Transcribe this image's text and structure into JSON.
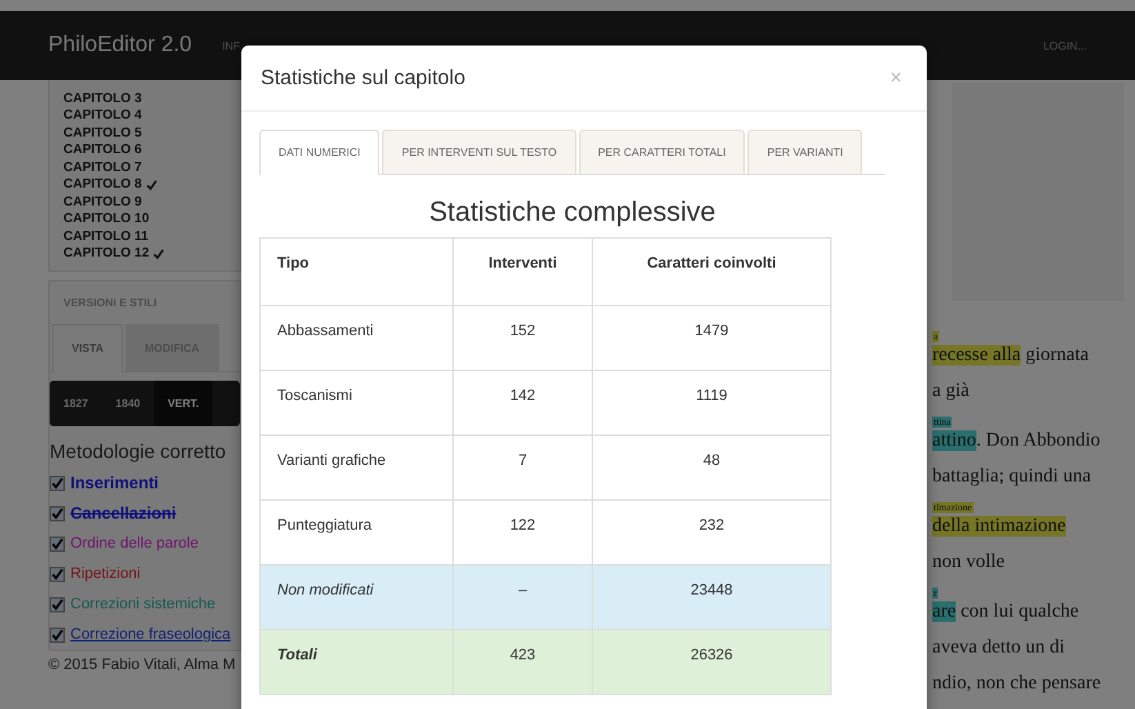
{
  "navbar": {
    "brand": "PhiloEditor 2.0",
    "menu": [
      "INF"
    ],
    "login": "LOGIN..."
  },
  "chapters": [
    {
      "label": "CAPITOLO 3",
      "completed": false
    },
    {
      "label": "CAPITOLO 4",
      "completed": false
    },
    {
      "label": "CAPITOLO 5",
      "completed": false
    },
    {
      "label": "CAPITOLO 6",
      "completed": false
    },
    {
      "label": "CAPITOLO 7",
      "completed": false
    },
    {
      "label": "CAPITOLO 8",
      "completed": true
    },
    {
      "label": "CAPITOLO 9",
      "completed": false
    },
    {
      "label": "CAPITOLO 10",
      "completed": false
    },
    {
      "label": "CAPITOLO 11",
      "completed": false
    },
    {
      "label": "CAPITOLO 12",
      "completed": true
    }
  ],
  "versions_panel": {
    "title": "VERSIONI E STILI",
    "tabs": [
      {
        "label": "VISTA",
        "selected": true
      },
      {
        "label": "MODIFICA",
        "selected": false
      }
    ],
    "version_buttons": [
      {
        "label": "1827",
        "selected": false
      },
      {
        "label": "1840",
        "selected": false
      },
      {
        "label": "VERT.",
        "selected": true
      }
    ]
  },
  "methods": {
    "title": "Metodologie corretto",
    "items": [
      {
        "label": "Inserimenti",
        "checked": true,
        "color": "#10107a",
        "kind": "bold"
      },
      {
        "label": "Cancellazioni",
        "checked": true,
        "color": "#10107a",
        "kind": "strike"
      },
      {
        "label": "Ordine delle parole",
        "checked": true,
        "color": "#6e146e",
        "kind": "plain"
      },
      {
        "label": "Ripetizioni",
        "checked": true,
        "color": "#741418",
        "kind": "plain"
      },
      {
        "label": "Correzioni sistemiche",
        "checked": true,
        "color": "#145a52",
        "kind": "plain"
      },
      {
        "label": "Correzione fraseologica",
        "checked": true,
        "color": "#102274",
        "kind": "underline"
      }
    ]
  },
  "footer": "© 2015 Fabio Vitali, Alma M",
  "text_lines": [
    {
      "note": {
        "text": "a",
        "color": "#767626"
      },
      "segments": [
        {
          "text": "recesse alla",
          "color": "#767626"
        },
        {
          "text": " giornata"
        }
      ]
    },
    {
      "segments": [
        {
          "text": "a già"
        }
      ]
    },
    {
      "note": {
        "text": "ttina",
        "color": "#2a6e6e"
      },
      "segments": [
        {
          "text": "attino",
          "color": "#2a6e6e"
        },
        {
          "text": ". Don Abbondio"
        }
      ]
    },
    {
      "segments": [
        {
          "text": "battaglia; quindi una"
        }
      ]
    },
    {
      "note": {
        "text": "timazione",
        "color": "#767626"
      },
      "segments": [
        {
          "text": "della intimazione",
          "color": "#767626"
        }
      ]
    },
    {
      "segments": [
        {
          "text": "non volle"
        }
      ]
    },
    {
      "note": {
        "text": "r",
        "color": "#2a6e6e"
      },
      "segments": [
        {
          "text": "are",
          "color": "#2a6e6e"
        },
        {
          "text": " con lui qualche"
        }
      ]
    },
    {
      "segments": [
        {
          "text": "aveva detto un di"
        }
      ]
    },
    {
      "segments": [
        {
          "text": "ndio, non che pensare"
        }
      ]
    }
  ],
  "modal": {
    "title": "Statistiche sul capitolo",
    "close": "×",
    "tabs": [
      {
        "label": "DATI NUMERICI",
        "selected": true
      },
      {
        "label": "PER INTERVENTI SUL TESTO",
        "selected": false
      },
      {
        "label": "PER CARATTERI TOTALI",
        "selected": false
      },
      {
        "label": "PER VARIANTI",
        "selected": false
      }
    ],
    "heading": "Statistiche complessive",
    "table": {
      "columns": [
        "Tipo",
        "Interventi",
        "Caratteri coinvolti"
      ],
      "rows": [
        {
          "kind": "normal",
          "cells": [
            "Abbassamenti",
            "152",
            "1479"
          ]
        },
        {
          "kind": "normal",
          "cells": [
            "Toscanismi",
            "142",
            "1119"
          ]
        },
        {
          "kind": "normal",
          "cells": [
            "Varianti grafiche",
            "7",
            "48"
          ]
        },
        {
          "kind": "normal",
          "cells": [
            "Punteggiatura",
            "122",
            "232"
          ]
        },
        {
          "kind": "info",
          "cells": [
            "Non modificati",
            "–",
            "23448"
          ]
        },
        {
          "kind": "total",
          "cells": [
            "Totali",
            "423",
            "26326"
          ]
        }
      ]
    }
  }
}
